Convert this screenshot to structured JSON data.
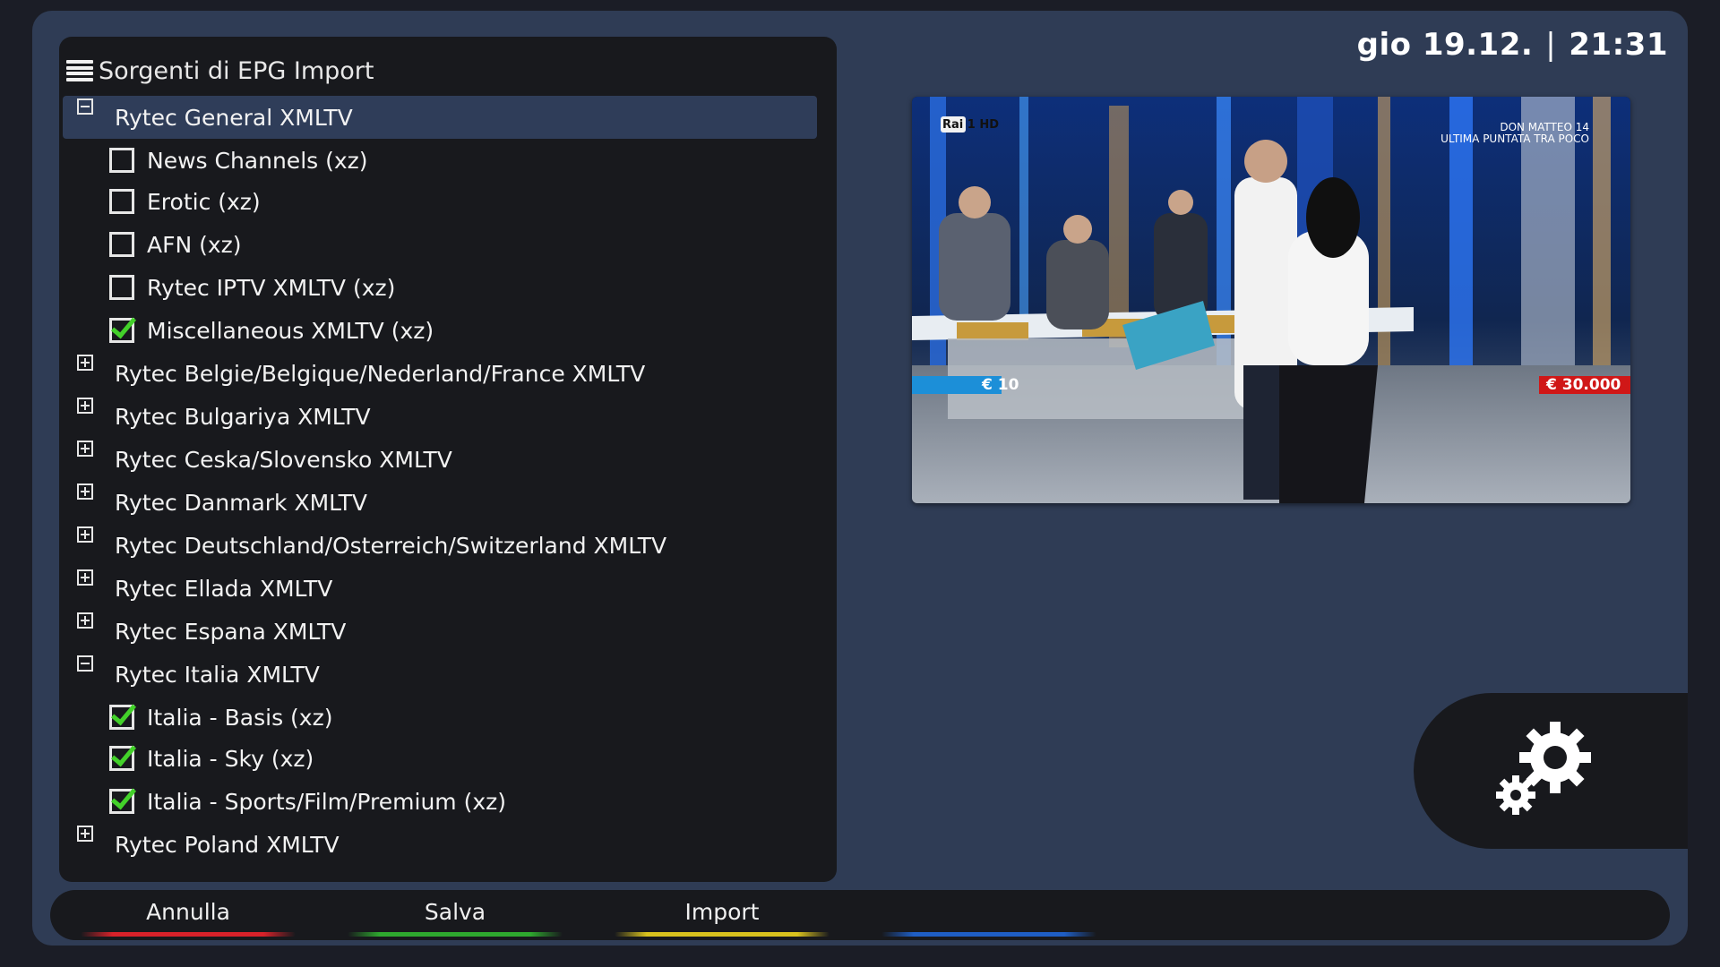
{
  "clock": {
    "day": "gio 19.12.",
    "separator": "|",
    "time": "21:31"
  },
  "panel": {
    "title": "Sorgenti di EPG Import",
    "icon": "hamburger-menu-icon",
    "rows": [
      {
        "label": "Rytec General XMLTV",
        "kind": "group",
        "expanded": true,
        "selected": true
      },
      {
        "label": "News Channels (xz)",
        "kind": "child",
        "checked": false
      },
      {
        "label": "Erotic (xz)",
        "kind": "child",
        "checked": false
      },
      {
        "label": "AFN (xz)",
        "kind": "child",
        "checked": false
      },
      {
        "label": "Rytec IPTV XMLTV (xz)",
        "kind": "child",
        "checked": false
      },
      {
        "label": "Miscellaneous XMLTV (xz)",
        "kind": "child",
        "checked": true
      },
      {
        "label": "Rytec Belgie/Belgique/Nederland/France XMLTV",
        "kind": "group",
        "expanded": false
      },
      {
        "label": "Rytec Bulgariya XMLTV",
        "kind": "group",
        "expanded": false
      },
      {
        "label": "Rytec Ceska/Slovensko XMLTV",
        "kind": "group",
        "expanded": false
      },
      {
        "label": "Rytec Danmark XMLTV",
        "kind": "group",
        "expanded": false
      },
      {
        "label": "Rytec Deutschland/Osterreich/Switzerland XMLTV",
        "kind": "group",
        "expanded": false
      },
      {
        "label": "Rytec Ellada XMLTV",
        "kind": "group",
        "expanded": false
      },
      {
        "label": "Rytec Espana XMLTV",
        "kind": "group",
        "expanded": false
      },
      {
        "label": "Rytec Italia XMLTV",
        "kind": "group",
        "expanded": true
      },
      {
        "label": "Italia - Basis (xz)",
        "kind": "child",
        "checked": true
      },
      {
        "label": "Italia - Sky (xz)",
        "kind": "child",
        "checked": true
      },
      {
        "label": "Italia - Sports/Film/Premium (xz)",
        "kind": "child",
        "checked": true
      },
      {
        "label": "Rytec Poland XMLTV",
        "kind": "group",
        "expanded": false
      }
    ]
  },
  "video": {
    "channel_logo": "Rai 1 HD",
    "overlay_line1": "DON MATTEO 14",
    "overlay_line2": "ULTIMA PUNTATA TRA POCO",
    "left_amount": "€ 10",
    "right_amount": "€ 30.000"
  },
  "settings": {
    "icon": "gears-icon"
  },
  "buttons": [
    {
      "label": "Annulla",
      "color": "#d8222a"
    },
    {
      "label": "Salva",
      "color": "#2ea82e"
    },
    {
      "label": "Import",
      "color": "#d9c21e"
    },
    {
      "label": "",
      "color": "#1f5ec4"
    }
  ],
  "colors": {
    "background": "#2f3c55",
    "panel": "#18191d",
    "selection": "#2f3d59",
    "check": "#43d12a"
  }
}
